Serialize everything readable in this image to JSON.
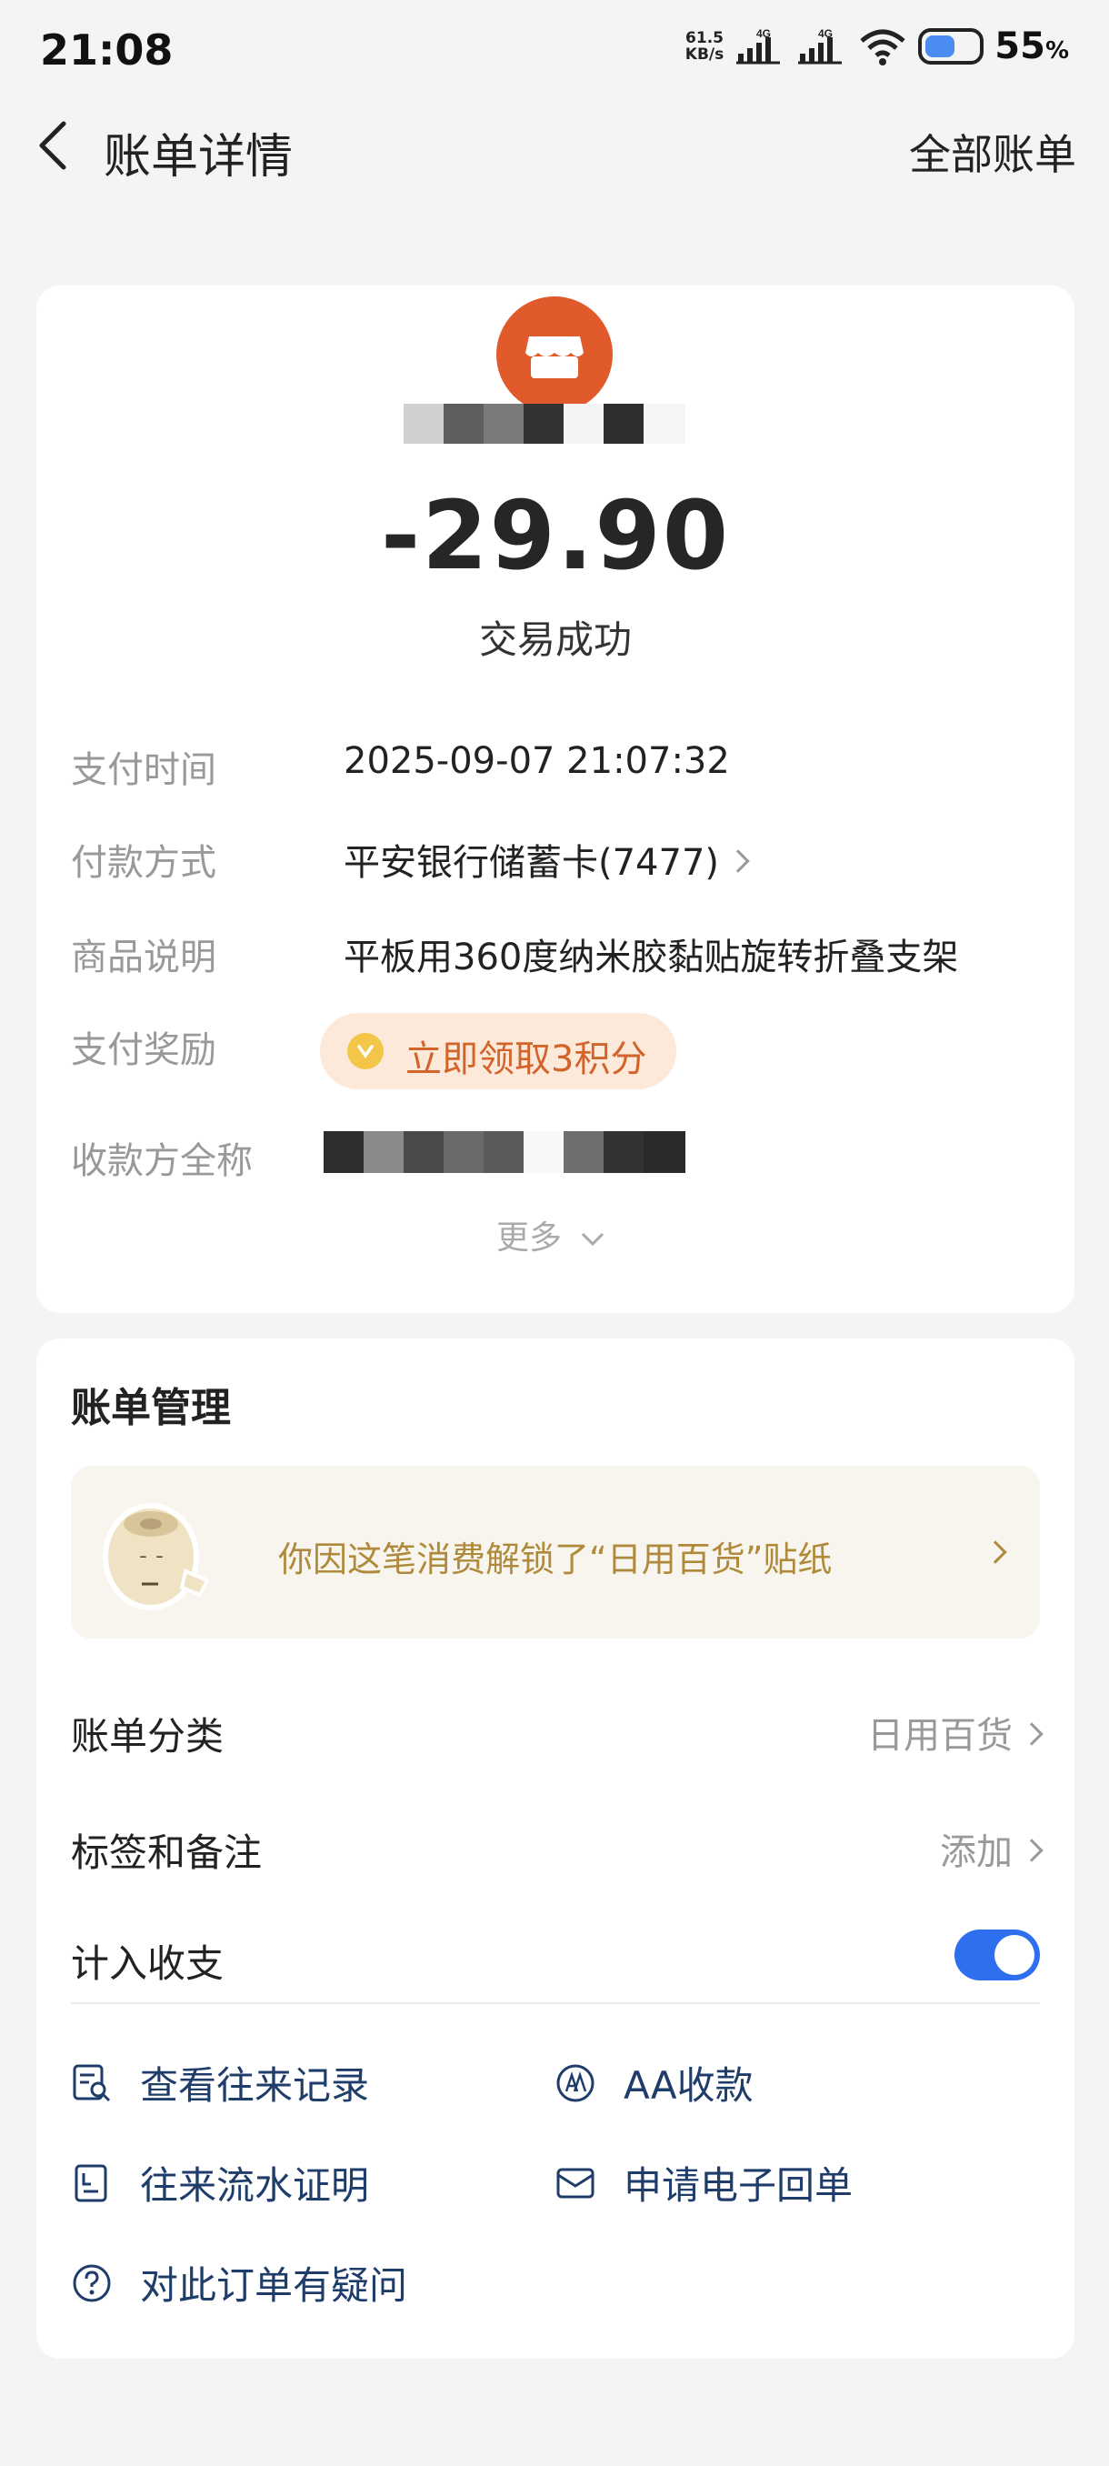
{
  "status_bar": {
    "time": "21:08",
    "net_speed_value": "61.5",
    "net_speed_unit": "KB/s",
    "signal_label_1": "4G",
    "signal_label_2": "4G",
    "battery_percent": "55",
    "battery_percent_sign": "%"
  },
  "nav": {
    "title": "账单详情",
    "right_link": "全部账单"
  },
  "summary": {
    "amount": "-29.90",
    "status": "交易成功"
  },
  "details": {
    "pay_time_label": "支付时间",
    "pay_time_value": "2025-09-07 21:07:32",
    "pay_method_label": "付款方式",
    "pay_method_value": "平安银行储蓄卡(7477)",
    "product_label": "商品说明",
    "product_value": "平板用360度纳米胶黏贴旋转折叠支架",
    "reward_label": "支付奖励",
    "reward_value": "立即领取3积分",
    "payee_label": "收款方全称",
    "more_label": "更多"
  },
  "management": {
    "title": "账单管理",
    "sticker_text": "你因这笔消费解锁了“日用百货”贴纸",
    "category_label": "账单分类",
    "category_value": "日用百货",
    "tags_label": "标签和备注",
    "tags_value": "添加",
    "count_label": "计入收支",
    "count_enabled": true
  },
  "actions": {
    "history": "查看往来记录",
    "aa": "AA收款",
    "statement": "往来流水证明",
    "receipt": "申请电子回单",
    "question": "对此订单有疑问"
  },
  "colors": {
    "accent_blue": "#2e6ff0",
    "merchant_orange": "#e05a2c",
    "reward_orange": "#d2642a",
    "sticker_gold": "#b08a3c",
    "action_navy": "#1f3d6a"
  },
  "icons": {
    "back": "chevron-left-icon",
    "merchant": "store-icon",
    "reward": "coin-icon",
    "history": "record-search-icon",
    "aa": "aa-icon",
    "statement": "document-icon",
    "receipt": "mail-icon",
    "question": "question-icon"
  }
}
